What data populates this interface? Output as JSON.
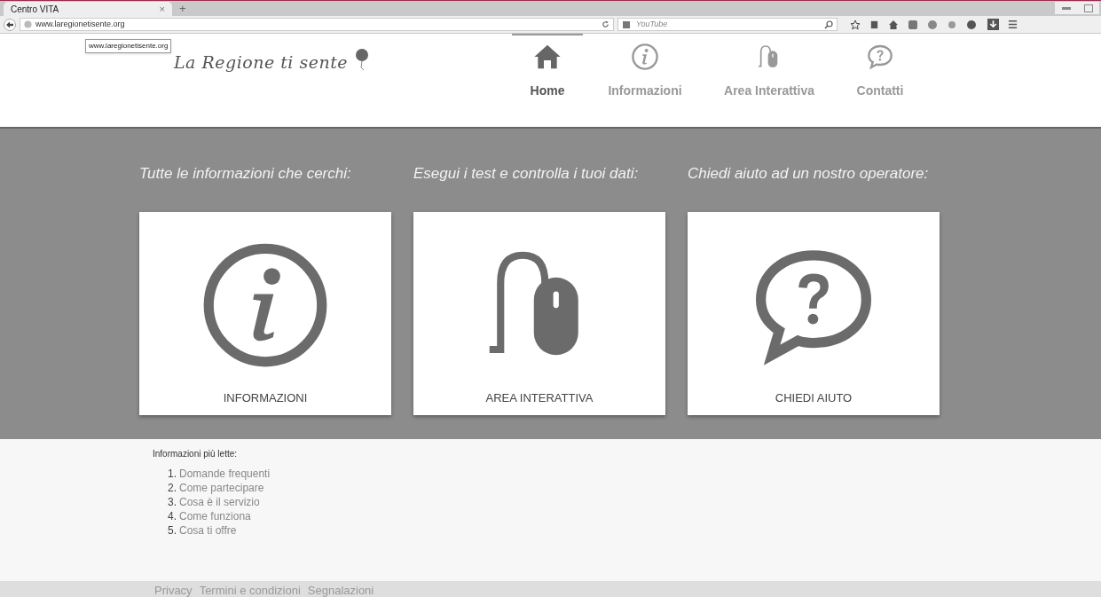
{
  "browser": {
    "tab": {
      "title": "Centro VITA",
      "close": "×"
    },
    "new_tab": "+",
    "url": "www.laregionetisente.org",
    "search": {
      "placeholder": "YouTube"
    },
    "tooltip": "www.laregionetisente.org"
  },
  "header": {
    "logo": "La Regione ti sente",
    "nav": [
      {
        "label": "Home",
        "kind": "home",
        "selected": true
      },
      {
        "label": "Informazioni",
        "kind": "info",
        "selected": false
      },
      {
        "label": "Area Interattiva",
        "kind": "mouse",
        "selected": false
      },
      {
        "label": "Contatti",
        "kind": "question",
        "selected": false
      }
    ]
  },
  "sections": [
    {
      "heading": "Tutte le informazioni che cerchi:",
      "kind": "info",
      "label": "INFORMAZIONI"
    },
    {
      "heading": "Esegui i test e controlla i tuoi dati:",
      "kind": "mouse",
      "label": "AREA INTERATTIVA"
    },
    {
      "heading": "Chiedi aiuto ad un nostro operatore:",
      "kind": "question",
      "label": "CHIEDI AIUTO"
    }
  ],
  "most_read": {
    "title": "Informazioni più lette:",
    "items": [
      {
        "number": "1.",
        "text": "Domande frequenti"
      },
      {
        "number": "2.",
        "text": "Come partecipare"
      },
      {
        "number": "3.",
        "text": "Cosa è il servizio"
      },
      {
        "number": "4.",
        "text": "Come funziona"
      },
      {
        "number": "5.",
        "text": "Cosa ti offre"
      }
    ]
  },
  "footer": {
    "links": [
      "Privacy",
      "Termini e condizioni",
      "Segnalazioni"
    ]
  }
}
